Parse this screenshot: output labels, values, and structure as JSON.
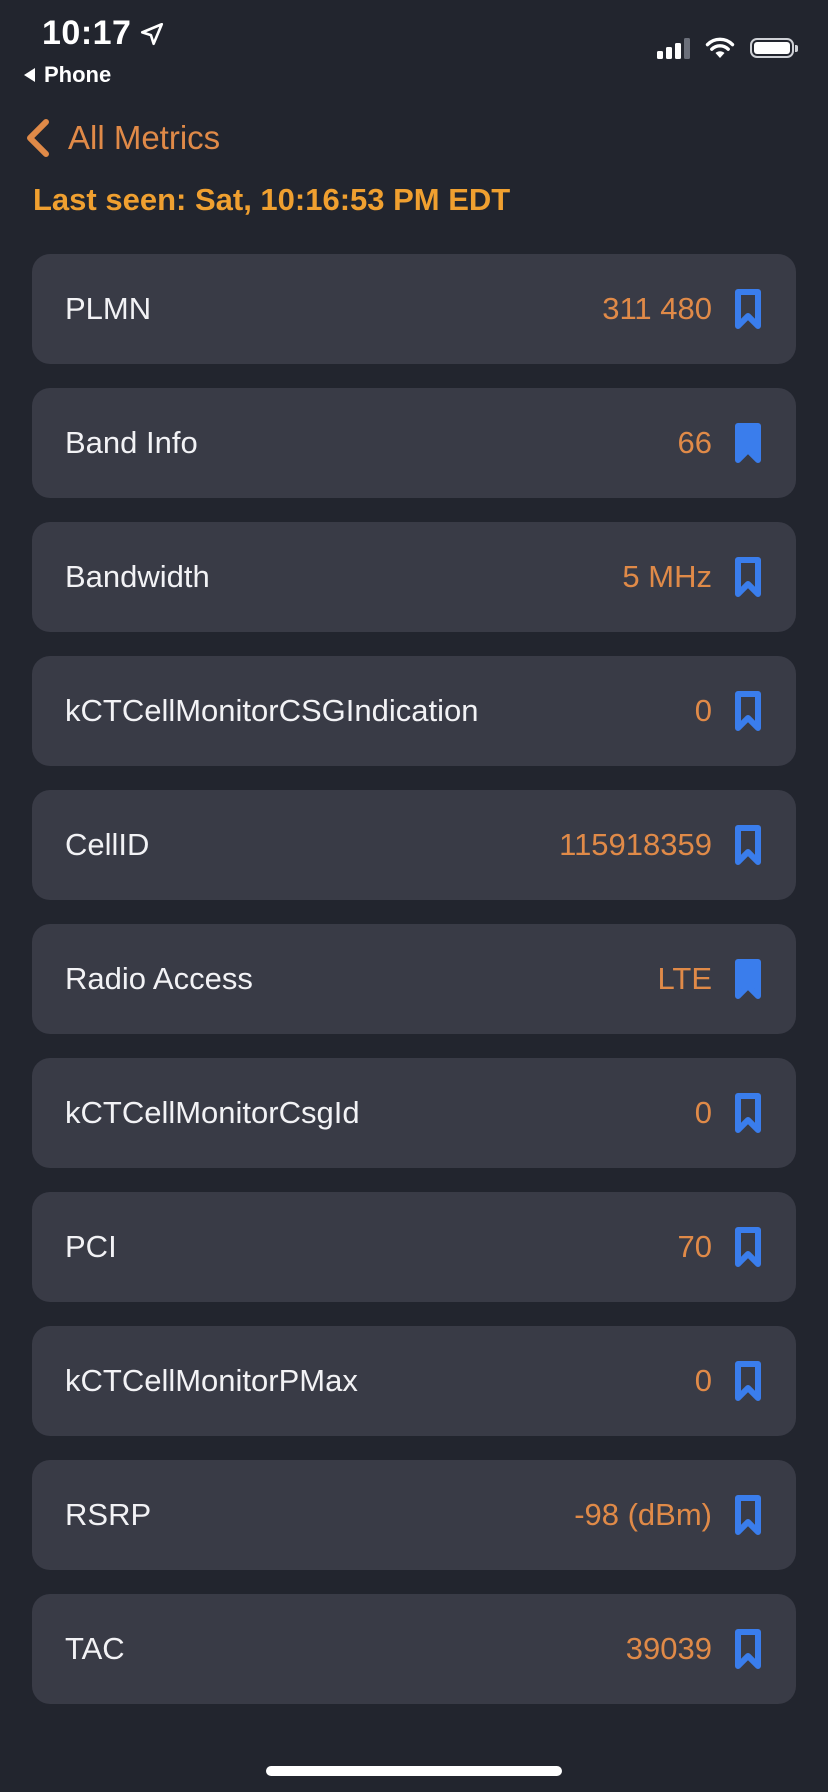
{
  "status_bar": {
    "time": "10:17",
    "back_app": "Phone"
  },
  "nav": {
    "back_label": "All Metrics"
  },
  "last_seen": "Last seen: Sat, 10:16:53 PM EDT",
  "colors": {
    "accent": "#e08a48",
    "last_seen": "#f0a030",
    "bookmark": "#3a7dec",
    "card": "#393b46",
    "background": "#22252e"
  },
  "metrics": [
    {
      "label": "PLMN",
      "value": "311 480",
      "bookmarked": false
    },
    {
      "label": "Band Info",
      "value": "66",
      "bookmarked": true
    },
    {
      "label": "Bandwidth",
      "value": "5 MHz",
      "bookmarked": false
    },
    {
      "label": "kCTCellMonitorCSGIndication",
      "value": "0",
      "bookmarked": false
    },
    {
      "label": "CellID",
      "value": "115918359",
      "bookmarked": false
    },
    {
      "label": "Radio Access",
      "value": "LTE",
      "bookmarked": true
    },
    {
      "label": "kCTCellMonitorCsgId",
      "value": "0",
      "bookmarked": false
    },
    {
      "label": "PCI",
      "value": "70",
      "bookmarked": false
    },
    {
      "label": "kCTCellMonitorPMax",
      "value": "0",
      "bookmarked": false
    },
    {
      "label": "RSRP",
      "value": "-98 (dBm)",
      "bookmarked": false
    },
    {
      "label": "TAC",
      "value": "39039",
      "bookmarked": false
    }
  ]
}
